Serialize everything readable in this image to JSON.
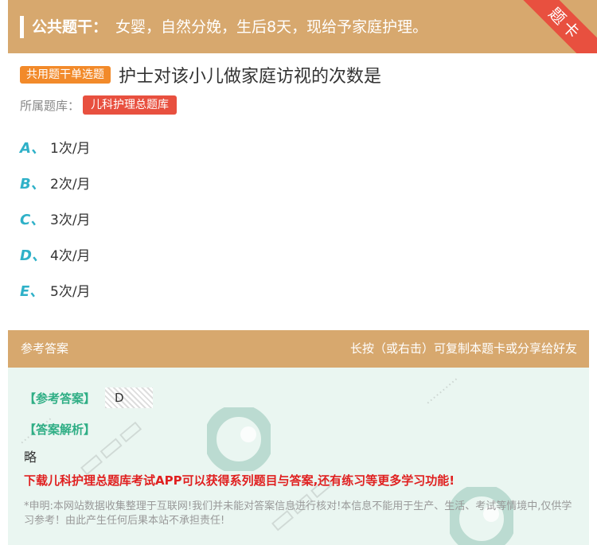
{
  "header": {
    "stem_label": "公共题干：",
    "stem_text": "女婴，自然分娩，生后8天，现给予家庭护理。",
    "ribbon": "题卡"
  },
  "question": {
    "type_tag": "共用题干单选题",
    "title": "护士对该小儿做家庭访视的次数是",
    "bank_label": "所属题库：",
    "bank_name": "儿科护理总题库"
  },
  "options": [
    {
      "letter": "A、",
      "text": "1次/月"
    },
    {
      "letter": "B、",
      "text": "2次/月"
    },
    {
      "letter": "C、",
      "text": "3次/月"
    },
    {
      "letter": "D、",
      "text": "4次/月"
    },
    {
      "letter": "E、",
      "text": "5次/月"
    }
  ],
  "answer_section": {
    "header_left": "参考答案",
    "header_right": "长按（或右击）可复制本题卡或分享给好友",
    "answer_label": "【参考答案】",
    "answer_value": "D",
    "analysis_label": "【答案解析】",
    "analysis_text": "略",
    "download_text": "下载儿科护理总题库考试APP可以获得系列题目与答案,还有练习等更多学习功能!",
    "disclaimer": "*申明:本网站数据收集整理于互联网!我们并未能对答案信息进行核对!本信息不能用于生产、生活、考试等情境中,仅供学习参考！由此产生任何后果本站不承担责任!"
  },
  "colors": {
    "header_bg": "#d7a86e",
    "ribbon_red": "#e8503f",
    "tag_orange": "#f28a2a",
    "option_letter": "#2fb1c8",
    "answer_green": "#2fae85",
    "download_red": "#e02020"
  }
}
